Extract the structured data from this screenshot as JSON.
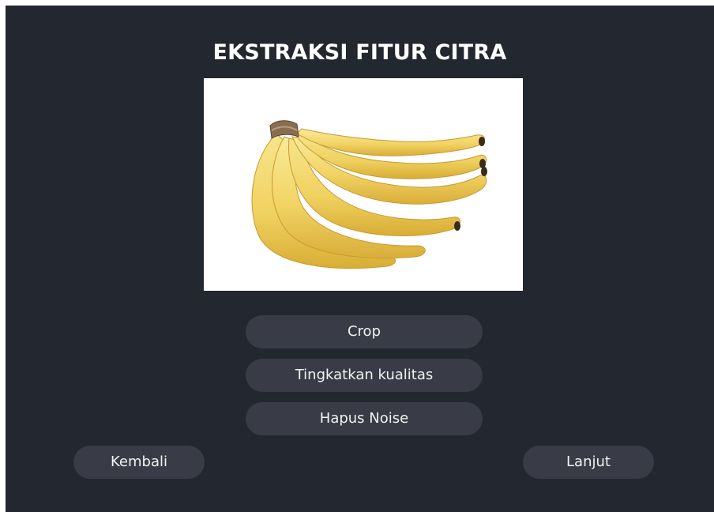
{
  "page": {
    "title": "EKSTRAKSI FITUR CITRA"
  },
  "image": {
    "subject": "banana-bunch"
  },
  "actions": {
    "crop_label": "Crop",
    "enhance_label": "Tingkatkan kualitas",
    "denoise_label": "Hapus Noise"
  },
  "navigation": {
    "back_label": "Kembali",
    "next_label": "Lanjut"
  },
  "colors": {
    "background": "#23272f",
    "button": "#393c46",
    "text": "#ffffff",
    "image_bg": "#ffffff"
  }
}
